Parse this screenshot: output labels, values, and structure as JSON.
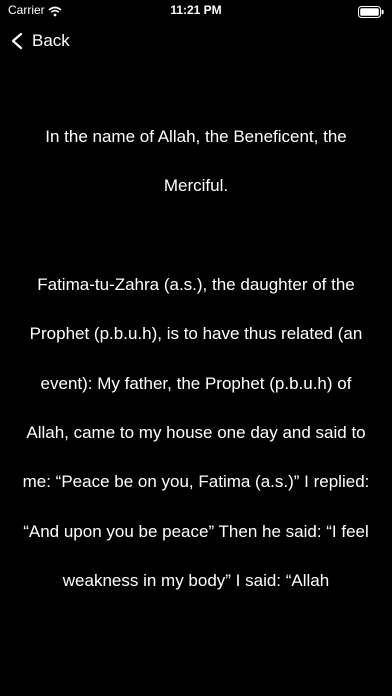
{
  "status_bar": {
    "carrier": "Carrier",
    "time": "11:21 PM",
    "icons": [
      "wifi-icon",
      "battery-icon"
    ]
  },
  "nav": {
    "back_label": "Back",
    "back_icon": "chevron-left-icon"
  },
  "content": {
    "paragraph_1": "In the name of Allah, the Beneficent, the Merciful.",
    "paragraph_2": "Fatima-tu-Zahra (a.s.), the daughter of the Prophet (p.b.u.h), is to have thus related (an event): My father, the Prophet (p.b.u.h) of Allah, came to my house one day and said to me: “Peace be on you, Fatima (a.s.)” I replied: “And upon you be peace” Then he said: “I feel weakness in my body” I said: “Allah"
  },
  "colors": {
    "background": "#000000",
    "text": "#ffffff"
  }
}
